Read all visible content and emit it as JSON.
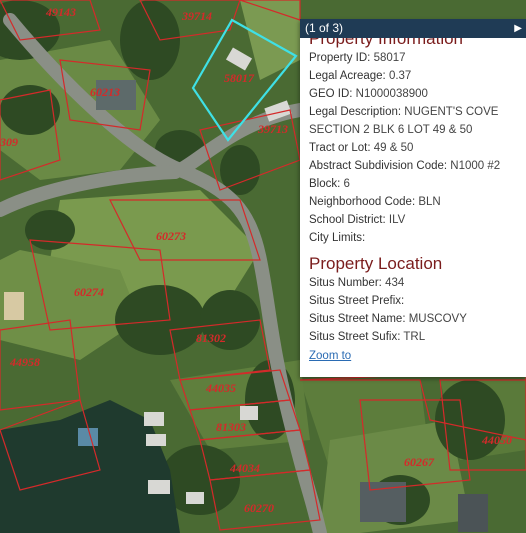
{
  "popup": {
    "counter": "(1 of 3)",
    "next_icon": "▶",
    "section1_title": "Property Information",
    "fields": [
      {
        "key": "Property ID:",
        "value": "58017"
      },
      {
        "key": "Legal Acreage:",
        "value": "0.37"
      },
      {
        "key": "GEO ID:",
        "value": "N1000038900"
      },
      {
        "key": "Legal Description:",
        "value": "NUGENT'S COVE SECTION 2 BLK 6 LOT 49 & 50"
      },
      {
        "key": "Tract or Lot:",
        "value": "49 & 50"
      },
      {
        "key": "Abstract Subdivision Code:",
        "value": "N1000 #2"
      },
      {
        "key": "Block:",
        "value": "6"
      },
      {
        "key": "Neighborhood Code:",
        "value": "BLN"
      },
      {
        "key": "School District:",
        "value": "ILV"
      },
      {
        "key": "City Limits:",
        "value": ""
      }
    ],
    "section2_title": "Property Location",
    "location_fields": [
      {
        "key": "Situs Number:",
        "value": "434"
      },
      {
        "key": "Situs Street Prefix:",
        "value": ""
      },
      {
        "key": "Situs Street Name:",
        "value": "MUSCOVY"
      },
      {
        "key": "Situs Street Sufix:",
        "value": "TRL"
      }
    ],
    "zoom_label": "Zoom to"
  },
  "map": {
    "parcel_labels": [
      "49143",
      "39714",
      "60213",
      "58017",
      "39713",
      "60273",
      "60274",
      "81302",
      "44958",
      "44035",
      "81303",
      "44034",
      "60270",
      "60267",
      "44050",
      "309"
    ],
    "selected_parcel_id": "58017",
    "colors": {
      "parcel_line": "#d42a2a",
      "selected_outline": "#3fe0e6",
      "road": "#8a8f86",
      "water": "#1f3a2e",
      "popup_header": "#1f3b55",
      "section_title": "#7a1c1c",
      "link": "#2a6bb3"
    }
  }
}
